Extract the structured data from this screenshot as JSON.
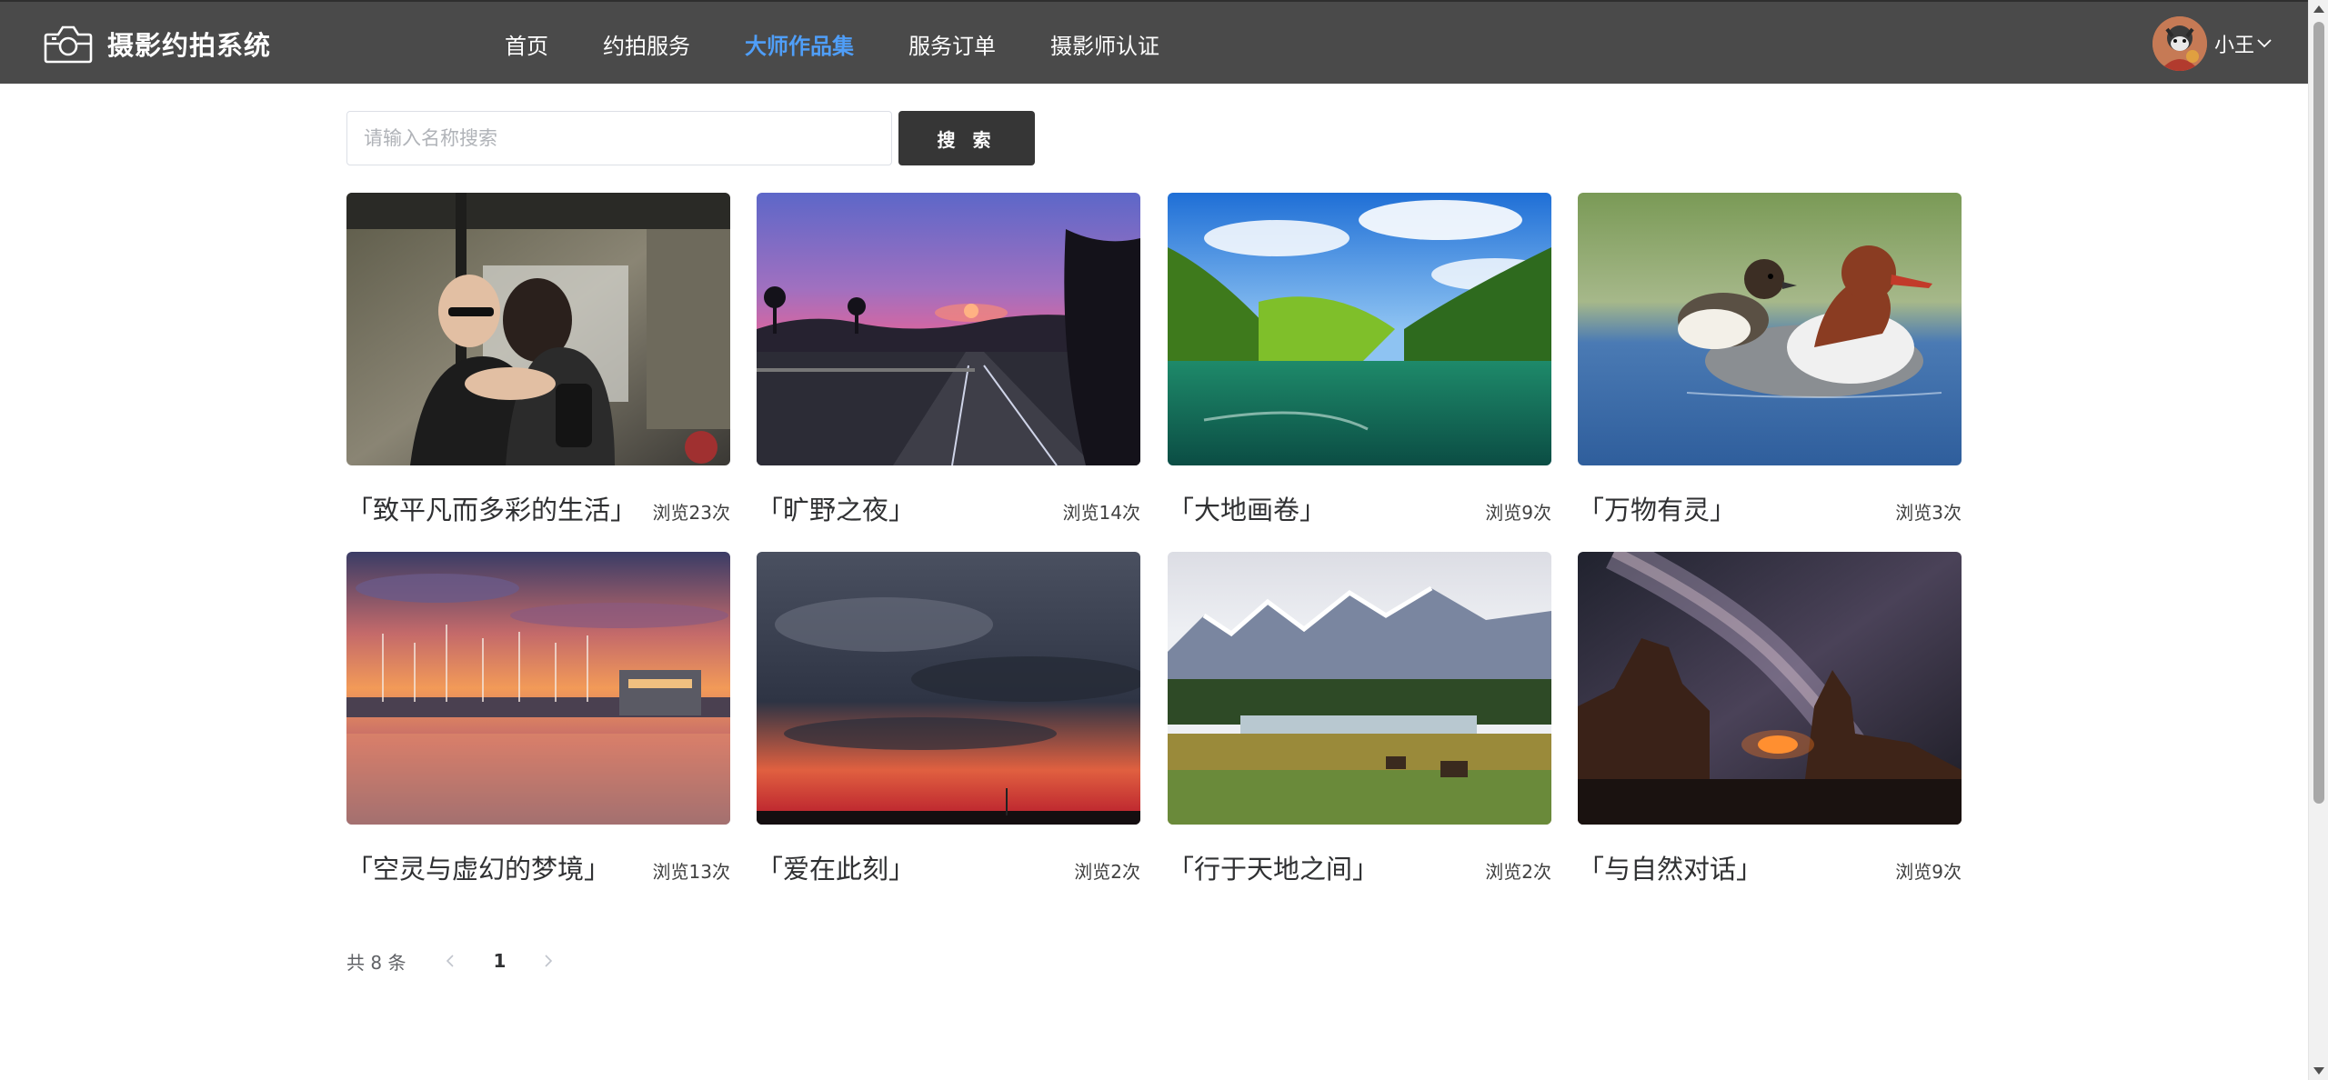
{
  "app": {
    "title": "摄影约拍系统"
  },
  "nav": {
    "items": [
      {
        "label": "首页"
      },
      {
        "label": "约拍服务"
      },
      {
        "label": "大师作品集",
        "active": true
      },
      {
        "label": "服务订单"
      },
      {
        "label": "摄影师认证"
      }
    ]
  },
  "user": {
    "name": "小王"
  },
  "search": {
    "placeholder": "请输入名称搜索",
    "value": "",
    "button_label": "搜 索"
  },
  "gallery": {
    "items": [
      {
        "title": "「致平凡而多彩的生活」",
        "views": "浏览23次",
        "image": "couple-street-photo"
      },
      {
        "title": "「旷野之夜」",
        "views": "浏览14次",
        "image": "sunset-highway-photo"
      },
      {
        "title": "「大地画卷」",
        "views": "浏览9次",
        "image": "green-valley-lake-photo"
      },
      {
        "title": "「万物有灵」",
        "views": "浏览3次",
        "image": "merganser-ducks-photo"
      },
      {
        "title": "「空灵与虚幻的梦境」",
        "views": "浏览13次",
        "image": "harbor-sunset-photo"
      },
      {
        "title": "「爱在此刻」",
        "views": "浏览2次",
        "image": "cloudy-dusk-photo"
      },
      {
        "title": "「行于天地之间」",
        "views": "浏览2次",
        "image": "alpine-meadow-photo"
      },
      {
        "title": "「与自然对话」",
        "views": "浏览9次",
        "image": "milky-way-rocks-photo"
      }
    ]
  },
  "pagination": {
    "total_label": "共 8 条",
    "current_page": "1"
  },
  "colors": {
    "header_bg": "#4a4a4a",
    "nav_active": "#4f9ef8",
    "button_bg": "#363636"
  }
}
